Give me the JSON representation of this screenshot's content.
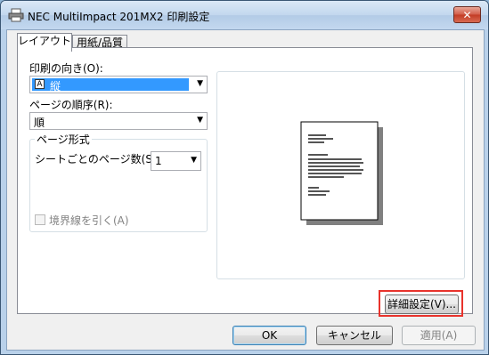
{
  "window": {
    "title": "NEC MultiImpact 201MX2 印刷設定",
    "close_label": "✕"
  },
  "tabs": [
    {
      "label": "レイアウト",
      "active": true
    },
    {
      "label": "用紙/品質",
      "active": false
    }
  ],
  "layout": {
    "orientation": {
      "label": "印刷の向き(O):",
      "value": "縦",
      "value_icon": "A"
    },
    "page_order": {
      "label": "ページの順序(R):",
      "value": "順"
    },
    "page_format": {
      "title": "ページ形式",
      "pages_per_sheet_label": "シートごとのページ数(S)",
      "pages_per_sheet_value": "1",
      "draw_borders_label": "境界線を引く(A)"
    }
  },
  "buttons": {
    "advanced": "詳細設定(V)...",
    "ok": "OK",
    "cancel": "キャンセル",
    "apply": "適用(A)"
  },
  "colors": {
    "highlight": "#e8332c",
    "selection": "#3399ff"
  }
}
